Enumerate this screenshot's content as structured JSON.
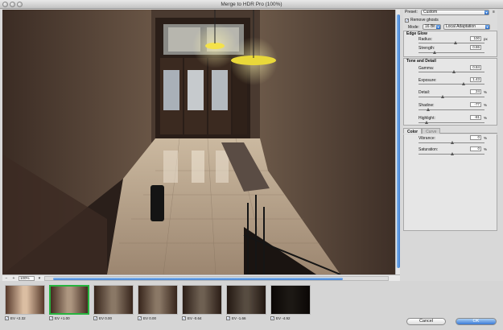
{
  "window": {
    "title": "Merge to HDR Pro (100%)"
  },
  "preview": {
    "zoom": "100%"
  },
  "panel": {
    "preset_label": "Preset:",
    "preset_value": "Custom",
    "remove_ghosts_label": "Remove ghosts",
    "remove_ghosts_checked": true,
    "mode_label": "Mode:",
    "mode_value": "16 Bit",
    "method_value": "Local Adaptation",
    "edge_glow": {
      "title": "Edge Glow",
      "radius": {
        "label": "Radius:",
        "value": "100",
        "unit": "px",
        "slider": 0.55
      },
      "strength": {
        "label": "Strength:",
        "value": "0.86",
        "unit": "",
        "slider": 0.22
      }
    },
    "tone_detail": {
      "title": "Tone and Detail",
      "gamma": {
        "label": "Gamma:",
        "value": "0.84",
        "unit": "",
        "slider": 0.52
      },
      "exposure": {
        "label": "Exposure:",
        "value": "1.43",
        "unit": "",
        "slider": 0.68
      },
      "detail": {
        "label": "Detail:",
        "value": "24",
        "unit": "%",
        "slider": 0.35
      },
      "shadow": {
        "label": "Shadow:",
        "value": "-77",
        "unit": "%",
        "slider": 0.12
      },
      "highlight": {
        "label": "Highlight:",
        "value": "-81",
        "unit": "%",
        "slider": 0.1
      }
    },
    "tabs": [
      {
        "label": "Color"
      },
      {
        "label": "Curve"
      }
    ],
    "color": {
      "vibrance": {
        "label": "Vibrance:",
        "value": "0",
        "unit": "%",
        "slider": 0.5
      },
      "saturation": {
        "label": "Saturation:",
        "value": "0",
        "unit": "%",
        "slider": 0.5
      }
    }
  },
  "filmstrip": {
    "items": [
      {
        "label": "EV +2.32",
        "selected": false
      },
      {
        "label": "EV +1.00",
        "selected": true
      },
      {
        "label": "EV 0.00",
        "selected": false
      },
      {
        "label": "EV 0.00",
        "selected": false
      },
      {
        "label": "EV -0.64",
        "selected": false
      },
      {
        "label": "EV -1.66",
        "selected": false
      },
      {
        "label": "EV -4.92",
        "selected": false
      }
    ]
  },
  "buttons": {
    "cancel": "Cancel",
    "ok": "OK"
  },
  "colors": {
    "accent": "#3a7ad6",
    "selected_thumb": "#27b33f"
  }
}
